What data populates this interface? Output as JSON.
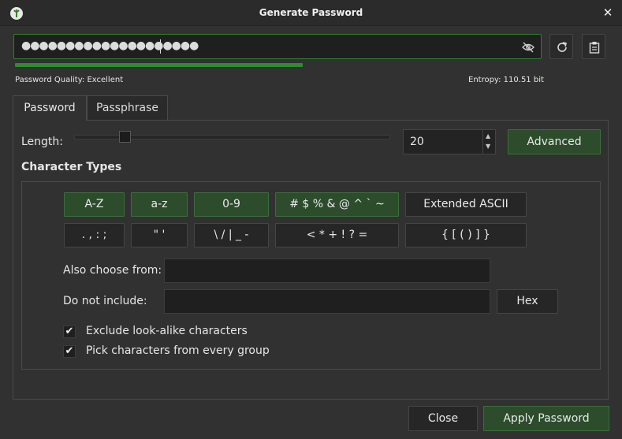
{
  "window": {
    "title": "Generate Password"
  },
  "password": {
    "masked_value": "●●●●●●●●●●●●●●●●●●●●",
    "quality_label": "Password Quality: Excellent",
    "entropy_label": "Entropy: 110.51 bit",
    "quality_fraction": 0.49
  },
  "tabs": [
    {
      "label": "Password",
      "active": true
    },
    {
      "label": "Passphrase",
      "active": false
    }
  ],
  "length": {
    "label": "Length:",
    "value": "20"
  },
  "advanced_label": "Advanced",
  "character_types": {
    "title": "Character Types",
    "row1": [
      "A-Z",
      "a-z",
      "0-9",
      "# $ % & @ ^ ` ~",
      "Extended ASCII"
    ],
    "row2": [
      ". , : ;",
      "\" '",
      "\\ / | _ -",
      "< * + ! ? =",
      "{ [ ( ) ] }"
    ]
  },
  "also_choose": {
    "label": "Also choose from:",
    "value": ""
  },
  "do_not_include": {
    "label": "Do not include:",
    "value": ""
  },
  "hex_label": "Hex",
  "checks": {
    "lookalike": "Exclude look-alike characters",
    "every_group": "Pick characters from every group"
  },
  "footer": {
    "close_label": "Close",
    "apply_label": "Apply Password"
  },
  "colors": {
    "accent_green": "#2e8b2e",
    "button_green": "#2c4c2c",
    "background": "#313131"
  },
  "icons": [
    "app-icon",
    "close-icon",
    "eye-off-icon",
    "regenerate-icon",
    "clipboard-icon",
    "check-icon"
  ]
}
